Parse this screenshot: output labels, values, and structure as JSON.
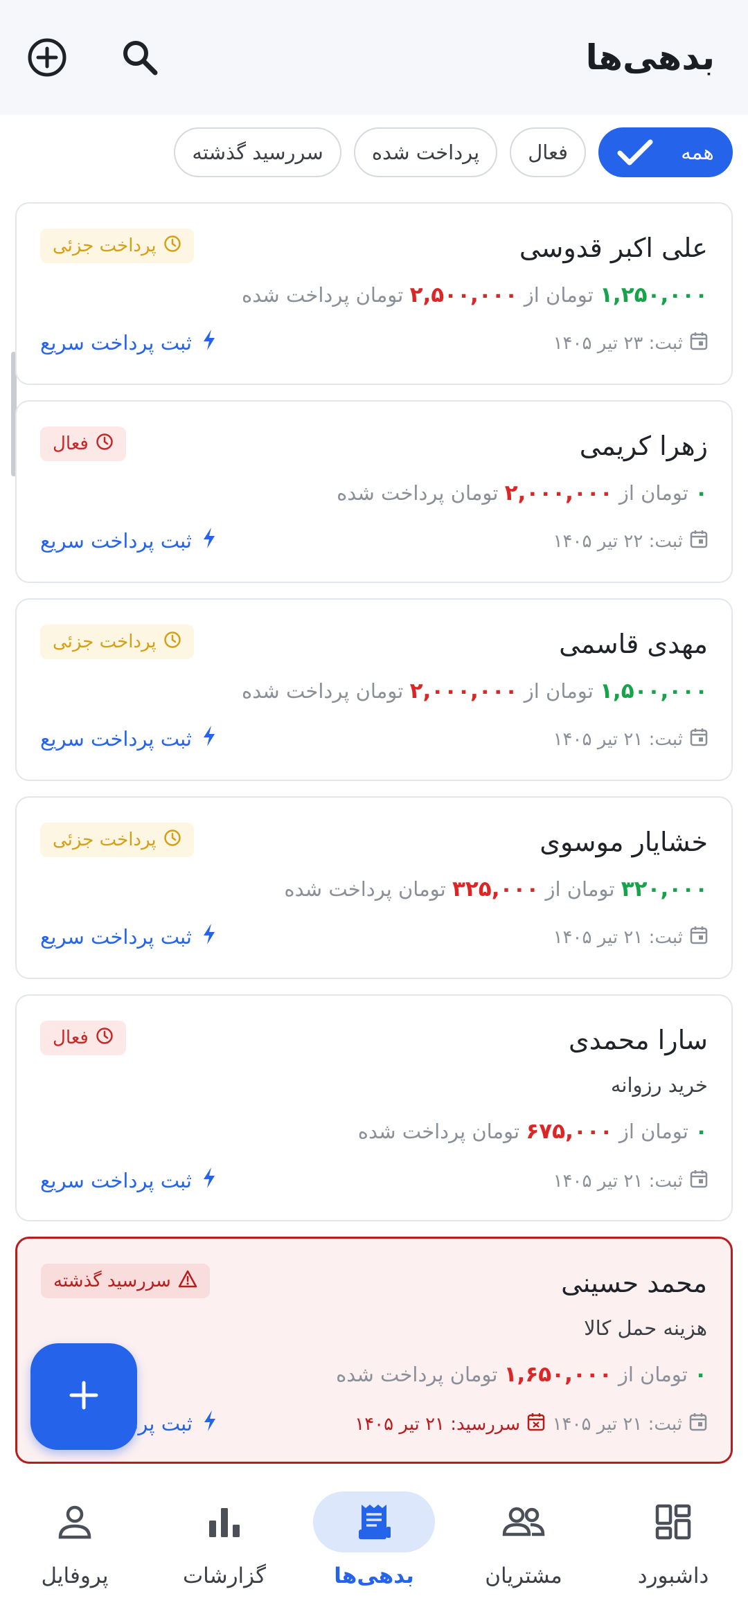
{
  "header": {
    "title": "بدهی‌ها",
    "search_icon": "search-icon",
    "add_icon": "add-circle-icon"
  },
  "filters": [
    {
      "label": "همه",
      "active": true
    },
    {
      "label": "فعال",
      "active": false
    },
    {
      "label": "پرداخت شده",
      "active": false
    },
    {
      "label": "سررسید گذشته",
      "active": false
    }
  ],
  "amount_words": {
    "of": "تومان از",
    "paid": "تومان پرداخت شده"
  },
  "quick_pay_label": "ثبت پرداخت سریع",
  "debts": [
    {
      "name": "علی اکبر قدوسی",
      "paid": "۱,۲۵۰,۰۰۰",
      "total": "۲,۵۰۰,۰۰۰",
      "registered": "ثبت: ۲۳ تیر ۱۴۰۵",
      "status": "پرداخت جزئی",
      "status_type": "partial"
    },
    {
      "name": "زهرا کریمی",
      "paid": "۰",
      "total": "۲,۰۰۰,۰۰۰",
      "registered": "ثبت: ۲۲ تیر ۱۴۰۵",
      "status": "فعال",
      "status_type": "active"
    },
    {
      "name": "مهدی قاسمی",
      "paid": "۱,۵۰۰,۰۰۰",
      "total": "۲,۰۰۰,۰۰۰",
      "registered": "ثبت: ۲۱ تیر ۱۴۰۵",
      "status": "پرداخت جزئی",
      "status_type": "partial"
    },
    {
      "name": "خشایار موسوی",
      "paid": "۳۲۰,۰۰۰",
      "total": "۳۲۵,۰۰۰",
      "registered": "ثبت: ۲۱ تیر ۱۴۰۵",
      "status": "پرداخت جزئی",
      "status_type": "partial"
    },
    {
      "name": "سارا محمدی",
      "description": "خرید رزوانه",
      "paid": "۰",
      "total": "۶۷۵,۰۰۰",
      "registered": "ثبت: ۲۱ تیر ۱۴۰۵",
      "status": "فعال",
      "status_type": "active"
    },
    {
      "name": "محمد حسینی",
      "description": "هزینه حمل کالا",
      "paid": "۰",
      "total": "۱,۶۵۰,۰۰۰",
      "registered": "ثبت: ۲۱ تیر ۱۴۰۵",
      "due": "سررسید: ۲۱ تیر ۱۴۰۵",
      "status": "سررسید گذشته",
      "status_type": "overdue"
    }
  ],
  "nav": [
    {
      "label": "داشبورد",
      "icon": "dashboard-icon",
      "active": false
    },
    {
      "label": "مشتریان",
      "icon": "customers-icon",
      "active": false
    },
    {
      "label": "بدهی‌ها",
      "icon": "receipt-icon",
      "active": true
    },
    {
      "label": "گزارشات",
      "icon": "bar-chart-icon",
      "active": false
    },
    {
      "label": "پروفایل",
      "icon": "person-icon",
      "active": false
    }
  ],
  "colors": {
    "accent": "#2563eb",
    "paid": "#16a34a",
    "total": "#dc2626",
    "partial": "#d4a017",
    "overdue": "#b91c1c"
  }
}
